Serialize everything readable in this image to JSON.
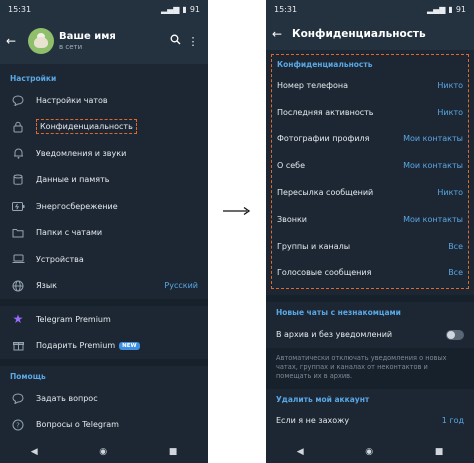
{
  "left": {
    "status": {
      "time": "15:31",
      "battery": "91"
    },
    "profile": {
      "name": "Ваше имя",
      "status": "в сети"
    },
    "settings_head": "Настройки",
    "items": [
      {
        "icon": "chat-bubble-icon",
        "label": "Настройки чатов"
      },
      {
        "icon": "lock-icon",
        "label": "Конфиденциальность"
      },
      {
        "icon": "bell-icon",
        "label": "Уведомления и звуки"
      },
      {
        "icon": "database-icon",
        "label": "Данные и память"
      },
      {
        "icon": "battery-icon",
        "label": "Энергосбережение"
      },
      {
        "icon": "folder-icon",
        "label": "Папки с чатами"
      },
      {
        "icon": "laptop-icon",
        "label": "Устройства"
      },
      {
        "icon": "globe-icon",
        "label": "Язык",
        "value": "Русский"
      }
    ],
    "premium": [
      {
        "icon": "star-icon",
        "label": "Telegram Premium"
      },
      {
        "icon": "gift-icon",
        "label": "Подарить Premium",
        "badge": "NEW"
      }
    ],
    "help_head": "Помощь",
    "help": [
      {
        "icon": "chat-bubble-icon",
        "label": "Задать вопрос"
      },
      {
        "icon": "question-icon",
        "label": "Вопросы о Telegram"
      }
    ]
  },
  "right": {
    "status": {
      "time": "15:31",
      "battery": "91"
    },
    "title": "Конфиденциальность",
    "privacy_head": "Конфиденциальность",
    "privacy": [
      {
        "label": "Номер телефона",
        "value": "Никто"
      },
      {
        "label": "Последняя активность",
        "value": "Никто"
      },
      {
        "label": "Фотографии профиля",
        "value": "Мои контакты"
      },
      {
        "label": "О себе",
        "value": "Мои контакты"
      },
      {
        "label": "Пересылка сообщений",
        "value": "Никто"
      },
      {
        "label": "Звонки",
        "value": "Мои контакты"
      },
      {
        "label": "Группы и каналы",
        "value": "Все"
      },
      {
        "label": "Голосовые сообщения",
        "value": "Все"
      }
    ],
    "new_chats_head": "Новые чаты с незнакомцами",
    "archive_label": "В архив и без уведомлений",
    "archive_note": "Автоматически отключать уведомления о новых чатах, группах и каналах от неконтактов и помещать их в архив.",
    "delete_head": "Удалить мой аккаунт",
    "delete_label": "Если я не захожу",
    "delete_value": "1 год"
  }
}
